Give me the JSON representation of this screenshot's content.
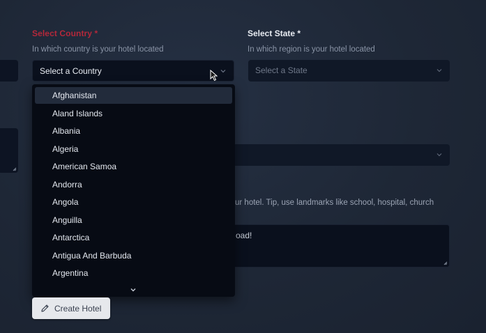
{
  "country": {
    "label": "Select Country *",
    "hint": "In which country is your hotel located",
    "selected": "Select a Country"
  },
  "state": {
    "label": "Select State *",
    "hint": "In which region is your hotel located",
    "placeholder": "Select a State"
  },
  "dropdown": {
    "options": [
      "Afghanistan",
      "Aland Islands",
      "Albania",
      "Algeria",
      "American Samoa",
      "Andorra",
      "Angola",
      "Anguilla",
      "Antarctica",
      "Antigua And Barbuda",
      "Argentina"
    ],
    "highlighted_index": 0
  },
  "address": {
    "hint_partial": "ur hotel. Tip, use landmarks like school, hospital, church",
    "value_partial": "oad!"
  },
  "submit": {
    "label": "Create Hotel"
  },
  "icons": {
    "chevron": "chevron-down-icon",
    "pencil": "pencil-icon",
    "cursor": "mouse-cursor-icon",
    "resize": "resize-handle-icon"
  }
}
